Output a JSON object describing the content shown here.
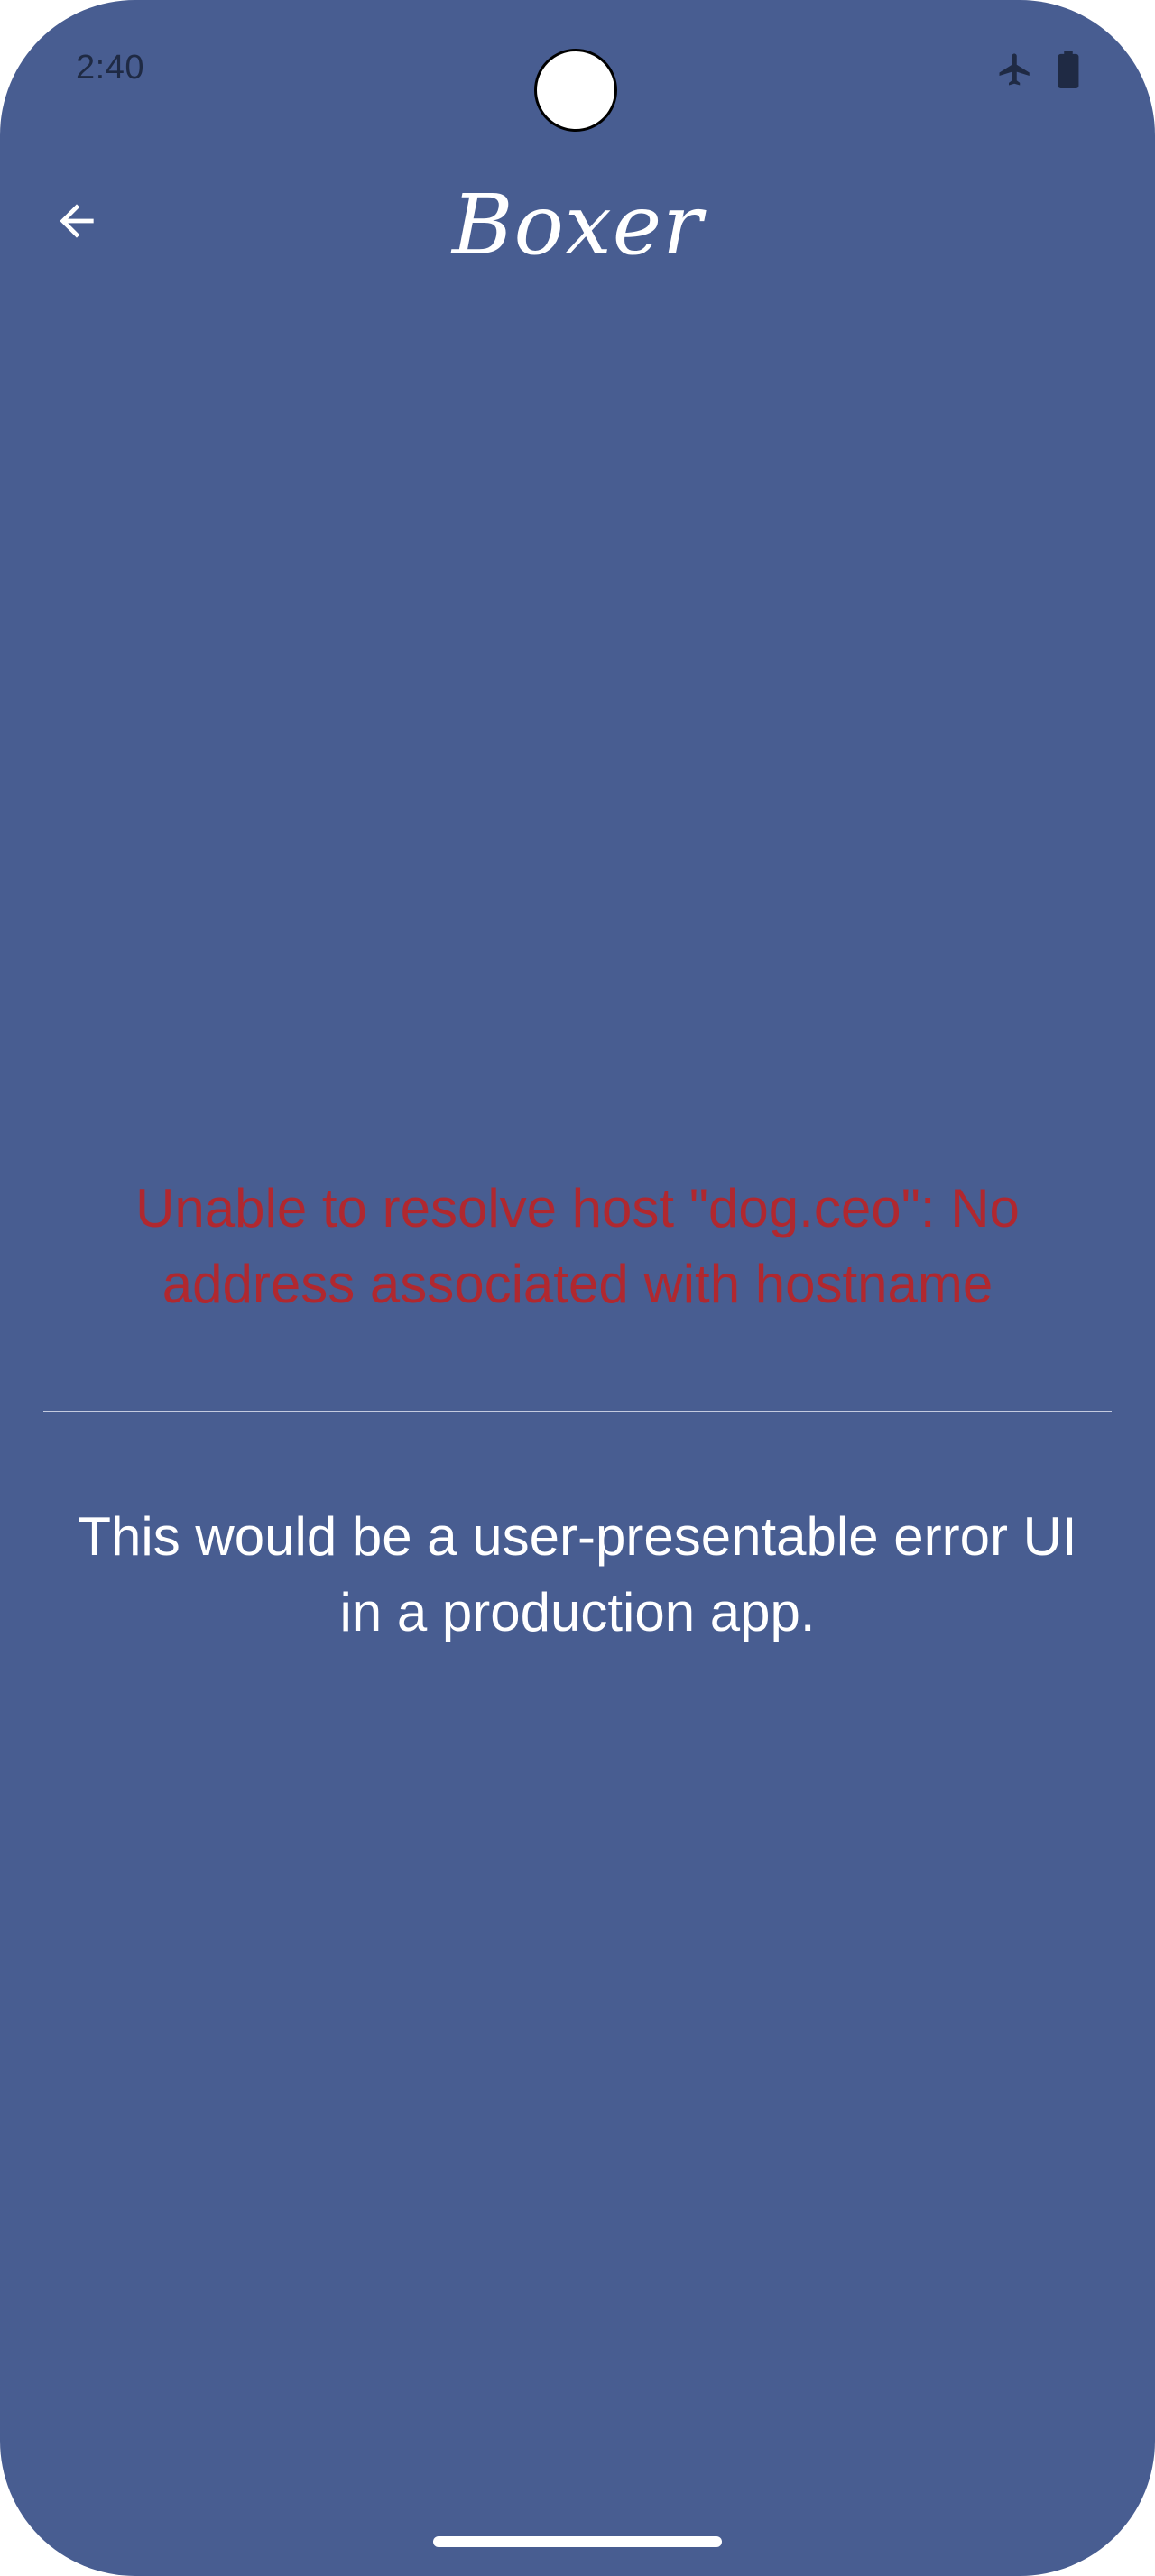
{
  "status_bar": {
    "time": "2:40",
    "icons": [
      "airplane-icon",
      "battery-icon"
    ],
    "text_color": "#1f2a44"
  },
  "top_bar": {
    "back_icon": "arrow-left-icon",
    "title": "Boxer"
  },
  "content": {
    "error_message": "Unable to resolve host \"dog.ceo\": No address associated with hostname",
    "info_message": "This would be a user-presentable error UI in a production app."
  },
  "colors": {
    "background": "#485d91",
    "error_text": "#b0282f",
    "primary_text": "#ffffff",
    "divider": "#c4cbe0"
  }
}
